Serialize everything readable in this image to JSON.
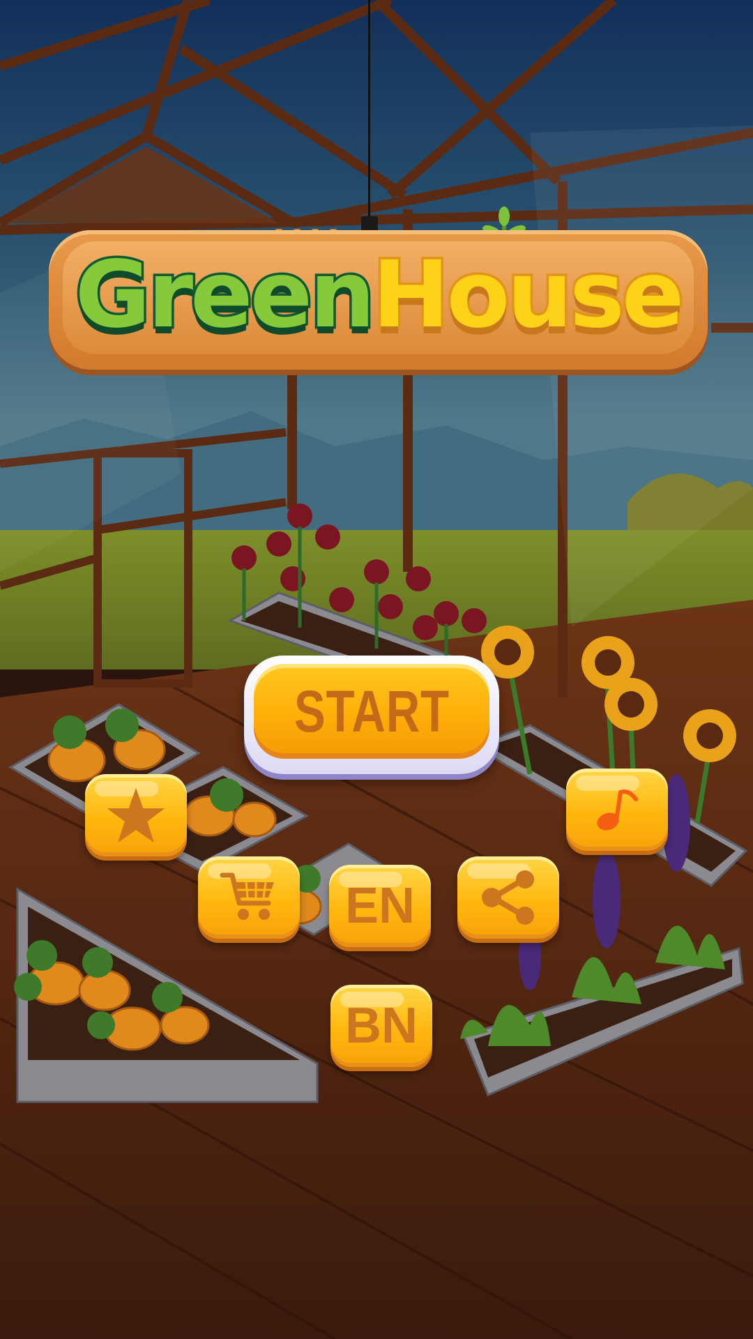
{
  "title": {
    "part1": "Green",
    "part2": "House"
  },
  "buttons": {
    "start": "START",
    "rate_icon": "star-icon",
    "music_icon": "music-note-icon",
    "shop_icon": "shopping-cart-icon",
    "language_en": "EN",
    "share_icon": "share-icon",
    "language_bn": "BN"
  },
  "colors": {
    "button_yellow": "#ffb70f",
    "button_text": "#cd7620",
    "title_green": "#86c93a",
    "title_yellow": "#ffd21a",
    "sign_wood": "#e89a4a"
  }
}
